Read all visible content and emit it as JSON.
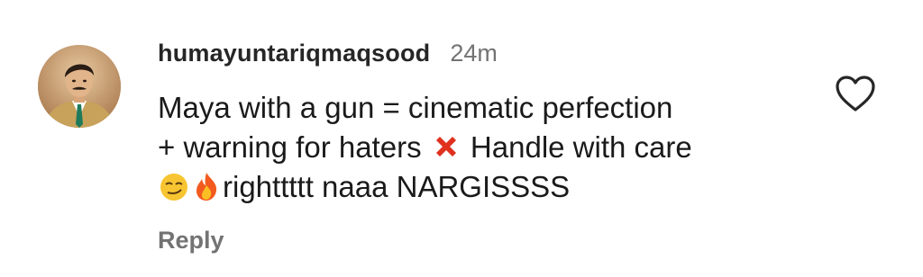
{
  "comment": {
    "username": "humayuntariqmaqsood",
    "timestamp": "24m",
    "text_line1": "Maya with a gun = cinematic perfection",
    "text_line2_before": "+ warning for haters",
    "text_line2_emoji": "cross-mark",
    "text_line2_after": "Handle with care",
    "text_line3_emojis": [
      "smirking-face",
      "fire"
    ],
    "text_line3_after": "righttttt naaa NARGISSSS",
    "reply_label": "Reply",
    "avatar_icon": "profile-photo",
    "like_icon": "heart-outline-icon"
  },
  "colors": {
    "username": "#262626",
    "secondary_text": "#737373",
    "body_text": "#1a1a1a",
    "cross_mark": "#e0301e",
    "background": "#ffffff"
  }
}
